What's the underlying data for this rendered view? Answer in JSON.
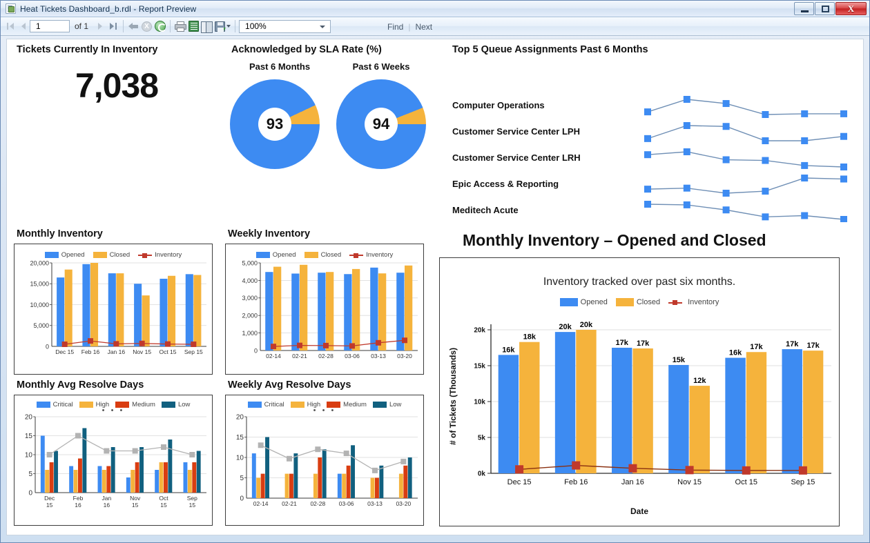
{
  "window": {
    "title": "Heat Tickets Dashboard_b.rdl - Report Preview",
    "minimize_label": "–",
    "maximize_label": "□",
    "close_label": "X"
  },
  "toolbar": {
    "first_page_tooltip": "First Page",
    "prev_page_tooltip": "Previous Page",
    "page_number": "1",
    "of_label": "of 1",
    "next_page_tooltip": "Next Page",
    "last_page_tooltip": "Last Page",
    "back_tooltip": "Back to Parent Report",
    "stop_label": "X",
    "refresh_tooltip": "Refresh",
    "print_tooltip": "Print",
    "page_setup_tooltip": "Page Setup",
    "print_layout_tooltip": "Print Layout",
    "export_tooltip": "Export",
    "zoom_value": "100%",
    "find_label": "Find",
    "separator": "|",
    "next_label": "Next"
  },
  "kpi": {
    "title": "Tickets Currently In Inventory",
    "value": "7,038"
  },
  "sla": {
    "title": "Acknowledged by SLA Rate (%)",
    "gauges": [
      {
        "label": "Past 6 Months",
        "value": "93",
        "pct": 93
      },
      {
        "label": "Past 6 Weeks",
        "value": "94",
        "pct": 94
      }
    ],
    "colors": {
      "filled": "#3d8bf2",
      "remainder": "#f5b33c"
    }
  },
  "top5": {
    "title": "Top 5 Queue Assignments Past 6 Months",
    "rows": [
      {
        "label": "Computer Operations",
        "values": [
          55,
          88,
          77,
          48,
          50,
          50
        ]
      },
      {
        "label": "Customer Service Center LPH",
        "values": [
          50,
          80,
          78,
          45,
          45,
          55
        ]
      },
      {
        "label": "Customer Service Center LRH",
        "values": [
          60,
          64,
          53,
          52,
          45,
          43
        ]
      },
      {
        "label": "Epic Access & Reporting",
        "values": [
          52,
          53,
          48,
          50,
          63,
          62
        ]
      },
      {
        "label": "Meditech Acute",
        "values": [
          56,
          55,
          47,
          36,
          38,
          32
        ]
      }
    ],
    "marker_color": "#3d8bf2",
    "line_color": "#6f8fb5"
  },
  "monthly_inventory": {
    "title": "Monthly Inventory",
    "chart_data": {
      "type": "bar",
      "title": "Monthly Inventory",
      "categories": [
        "Dec\n15",
        "Feb\n16",
        "Jan\n16",
        "Nov\n15",
        "Oct\n15",
        "Sep\n15"
      ],
      "category_labels": [
        [
          "Dec",
          "15"
        ],
        [
          "Feb",
          "16"
        ],
        [
          "Jan",
          "16"
        ],
        [
          "Nov",
          "15"
        ],
        [
          "Oct",
          "15"
        ],
        [
          "Sep",
          "15"
        ]
      ],
      "series": [
        {
          "name": "Opened",
          "type": "bar",
          "color": "#3d8bf2",
          "values": [
            16500,
            19700,
            17500,
            15000,
            16200,
            17300
          ]
        },
        {
          "name": "Closed",
          "type": "bar",
          "color": "#f5b33c",
          "values": [
            18400,
            20000,
            17500,
            12200,
            16900,
            17100
          ]
        },
        {
          "name": "Inventory",
          "type": "line",
          "color": "#c0392b",
          "values": [
            500,
            1300,
            600,
            700,
            550,
            500
          ]
        }
      ],
      "ylim": [
        0,
        20000
      ],
      "yticks": [
        "0",
        "5,000",
        "10,000",
        "15,000",
        "20,000"
      ],
      "xlabel": "",
      "ylabel": "",
      "grid": true,
      "legend_position": "top"
    }
  },
  "weekly_inventory": {
    "title": "Weekly Inventory",
    "chart_data": {
      "type": "bar",
      "title": "Weekly Inventory",
      "categories": [
        "02-14",
        "02-21",
        "02-28",
        "03-06",
        "03-13",
        "03-20"
      ],
      "series": [
        {
          "name": "Opened",
          "type": "bar",
          "color": "#3d8bf2",
          "values": [
            4480,
            4390,
            4440,
            4360,
            4730,
            4440
          ]
        },
        {
          "name": "Closed",
          "type": "bar",
          "color": "#f5b33c",
          "values": [
            4780,
            4890,
            4480,
            4650,
            4400,
            4850
          ]
        },
        {
          "name": "Inventory",
          "type": "line",
          "color": "#c0392b",
          "values": [
            230,
            290,
            280,
            260,
            440,
            580
          ]
        }
      ],
      "ylim": [
        0,
        5000
      ],
      "yticks": [
        "0",
        "1,000",
        "2,000",
        "3,000",
        "4,000",
        "5,000"
      ],
      "xlabel": "",
      "ylabel": "",
      "grid": true,
      "legend_position": "top"
    }
  },
  "monthly_resolve": {
    "title": "Monthly Avg Resolve Days",
    "chart_data": {
      "type": "bar",
      "title": "Monthly Avg Resolve Days",
      "categories": [
        [
          "Dec",
          "15"
        ],
        [
          "Feb",
          "16"
        ],
        [
          "Jan",
          "16"
        ],
        [
          "Nov",
          "15"
        ],
        [
          "Oct",
          "15"
        ],
        [
          "Sep",
          "15"
        ]
      ],
      "series": [
        {
          "name": "Critical",
          "type": "bar",
          "color": "#3d8bf2",
          "values": [
            15,
            7,
            7,
            4,
            6,
            8
          ]
        },
        {
          "name": "High",
          "type": "bar",
          "color": "#f5b33c",
          "values": [
            6,
            6,
            6,
            6,
            8,
            6
          ]
        },
        {
          "name": "Medium",
          "type": "bar",
          "color": "#d93d11",
          "values": [
            8,
            9,
            7,
            8,
            8,
            8
          ]
        },
        {
          "name": "Low",
          "type": "bar",
          "color": "#11607f",
          "values": [
            11,
            17,
            12,
            12,
            14,
            11
          ]
        },
        {
          "name": "",
          "type": "line",
          "color": "#b3b3b3",
          "values": [
            10,
            15,
            11,
            11,
            12,
            10
          ]
        }
      ],
      "ylim": [
        0,
        20
      ],
      "yticks": [
        "0",
        "5",
        "10",
        "15",
        "20"
      ],
      "xlabel": "",
      "ylabel": "",
      "grid": true,
      "legend_position": "top",
      "legend_overflow": "• • •"
    }
  },
  "weekly_resolve": {
    "title": "Weekly Avg Resolve Days",
    "chart_data": {
      "type": "bar",
      "title": "Weekly Avg Resolve Days",
      "categories": [
        "02-14",
        "02-21",
        "02-28",
        "03-06",
        "03-13",
        "03-20"
      ],
      "series": [
        {
          "name": "Critical",
          "type": "bar",
          "color": "#3d8bf2",
          "values": [
            11,
            0,
            0,
            6,
            0,
            0
          ]
        },
        {
          "name": "High",
          "type": "bar",
          "color": "#f5b33c",
          "values": [
            5,
            6,
            6,
            6,
            5,
            6
          ]
        },
        {
          "name": "Medium",
          "type": "bar",
          "color": "#d93d11",
          "values": [
            6,
            6,
            10,
            8,
            5,
            8
          ]
        },
        {
          "name": "Low",
          "type": "bar",
          "color": "#11607f",
          "values": [
            15,
            11,
            12,
            13,
            8,
            10
          ]
        },
        {
          "name": "",
          "type": "line",
          "color": "#b3b3b3",
          "values": [
            13,
            9.7,
            12,
            11,
            6.8,
            9
          ]
        }
      ],
      "ylim": [
        0,
        20
      ],
      "yticks": [
        "0",
        "5",
        "10",
        "15",
        "20"
      ],
      "xlabel": "",
      "ylabel": "",
      "grid": true,
      "legend_position": "top",
      "legend_overflow": "• • •"
    }
  },
  "big_chart": {
    "title": "Monthly Inventory – Opened and Closed",
    "chart_data": {
      "type": "bar",
      "title": "Inventory tracked over past six months.",
      "subtitle": "Inventory tracked over past six months.",
      "categories": [
        "Dec 15",
        "Feb 16",
        "Jan 16",
        "Nov 15",
        "Oct 15",
        "Sep 15"
      ],
      "series": [
        {
          "name": "Opened",
          "type": "bar",
          "color": "#3d8bf2",
          "values": [
            16500,
            19700,
            17500,
            15100,
            16100,
            17300
          ],
          "labels": [
            "16k",
            "20k",
            "17k",
            "15k",
            "16k",
            "17k"
          ]
        },
        {
          "name": "Closed",
          "type": "bar",
          "color": "#f5b33c",
          "values": [
            18300,
            20000,
            17400,
            12200,
            16900,
            17100
          ],
          "labels": [
            "18k",
            "20k",
            "17k",
            "12k",
            "17k",
            "17k"
          ]
        },
        {
          "name": "Inventory",
          "type": "line",
          "color": "#c0392b",
          "values": [
            550,
            1100,
            700,
            450,
            400,
            400
          ],
          "labels": []
        }
      ],
      "ylim": [
        0,
        20000
      ],
      "yticks": [
        "0k",
        "5k",
        "10k",
        "15k",
        "20k"
      ],
      "xlabel": "Date",
      "ylabel": "# of Tickets (Thousands)",
      "grid": true,
      "legend_position": "top"
    }
  },
  "palette": {
    "blue": "#3d8bf2",
    "orange": "#f5b33c",
    "red": "#c0392b",
    "medium_red": "#d93d11",
    "teal": "#11607f",
    "gray": "#b3b3b3"
  }
}
